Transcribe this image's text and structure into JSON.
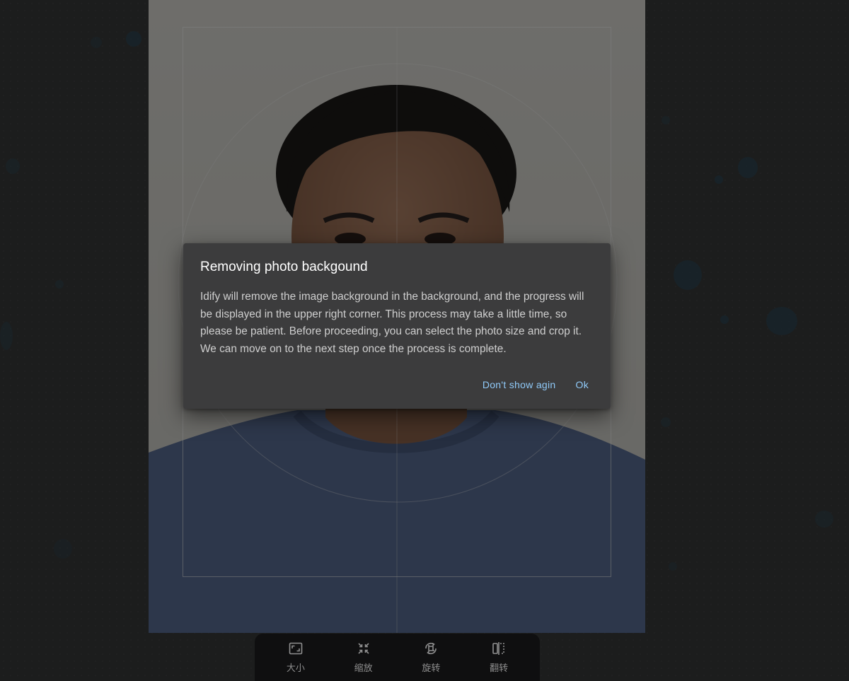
{
  "dialog": {
    "title": "Removing photo backgound",
    "body": "Idify will remove the image background in the background, and the progress will be displayed in the upper right corner. This process may take a little time, so please be patient. Before proceeding, you can select the photo size and crop it. We can move on to the next step once the process is complete.",
    "dont_show_label": "Don't show agin",
    "ok_label": "Ok"
  },
  "toolbar": {
    "items": [
      {
        "label": "大小",
        "icon": "crop-size-icon"
      },
      {
        "label": "缩放",
        "icon": "shrink-icon"
      },
      {
        "label": "旋转",
        "icon": "rotate-icon"
      },
      {
        "label": "翻转",
        "icon": "flip-icon"
      }
    ]
  },
  "colors": {
    "accent": "#90caf9",
    "dialog_bg": "#3c3c3d",
    "toolbar_bg": "#0f0f10"
  }
}
